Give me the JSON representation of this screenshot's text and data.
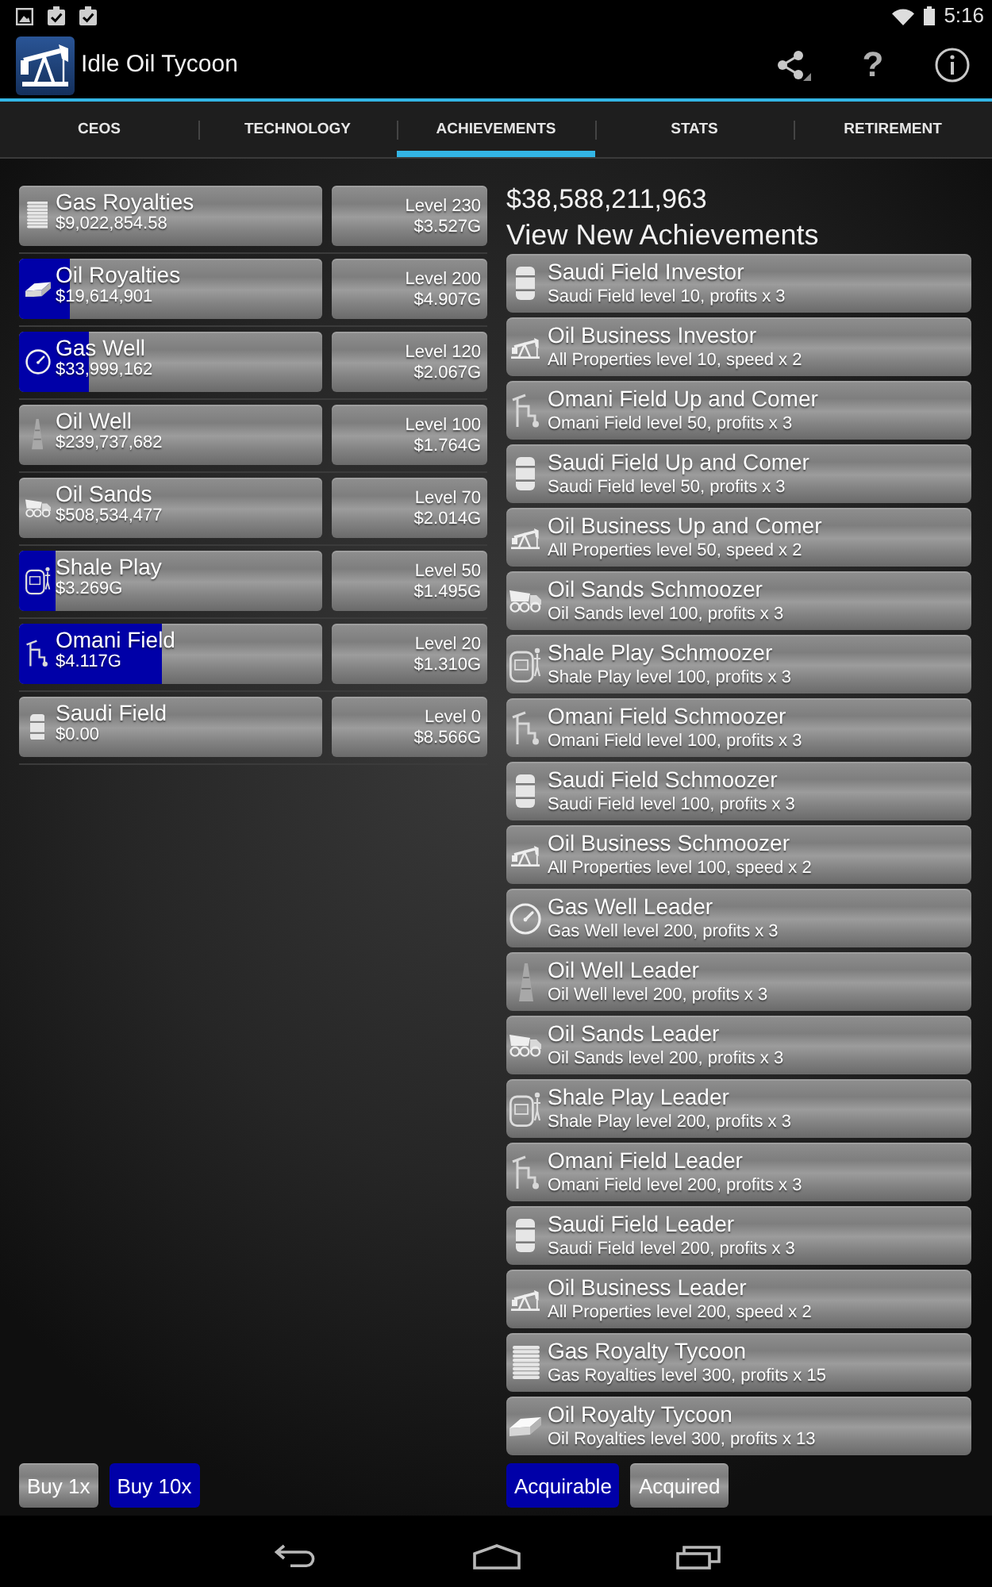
{
  "status_bar": {
    "time": "5:16"
  },
  "app_bar": {
    "title": "Idle Oil Tycoon",
    "help": "?"
  },
  "tabs": [
    {
      "label": "CEOS",
      "selected": false
    },
    {
      "label": "TECHNOLOGY",
      "selected": false
    },
    {
      "label": "ACHIEVEMENTS",
      "selected": true
    },
    {
      "label": "STATS",
      "selected": false
    },
    {
      "label": "RETIREMENT",
      "selected": false
    }
  ],
  "properties": [
    {
      "kind": "coins",
      "name": "Gas Royalties",
      "earnings": "$9,022,854.58",
      "level_text": "Level 230",
      "cost": "$3.527G"
    },
    {
      "kind": "ingot",
      "name": "Oil Royalties",
      "earnings": "$19,614,901",
      "level": 0.17,
      "level_text": "Level 200",
      "cost": "$4.907G"
    },
    {
      "kind": "gauge",
      "name": "Gas Well",
      "earnings": "$33,999,162",
      "level": 0.23,
      "level_text": "Level 120",
      "cost": "$2.067G"
    },
    {
      "kind": "derrick",
      "name": "Oil Well",
      "earnings": "$239,737,682",
      "level_text": "Level 100",
      "cost": "$1.764G"
    },
    {
      "kind": "truck",
      "name": "Oil Sands",
      "earnings": "$508,534,477",
      "level_text": "Level 70",
      "cost": "$2.014G"
    },
    {
      "kind": "tank",
      "name": "Shale Play",
      "earnings": "$3.269G",
      "level": 0.12,
      "level_text": "Level 50",
      "cost": "$1.495G"
    },
    {
      "kind": "pipeline",
      "name": "Omani Field",
      "earnings": "$4.117G",
      "level": 0.47,
      "level_text": "Level 20",
      "cost": "$1.310G"
    },
    {
      "kind": "barrel",
      "name": "Saudi Field",
      "earnings": "$0.00",
      "level_text": "Level 0",
      "cost": "$8.566G"
    }
  ],
  "buy_modes": [
    {
      "label": "Buy 1x",
      "selected": false
    },
    {
      "label": "Buy 10x",
      "selected": true
    }
  ],
  "balance": "$38,588,211,963",
  "achievements_heading": "View New Achievements",
  "achievements": [
    {
      "kind": "barrel",
      "title": "Saudi Field Investor",
      "requirement": "Saudi Field level 10, profits x 3"
    },
    {
      "kind": "pumpjack",
      "title": "Oil Business Investor",
      "requirement": "All Properties level 10, speed x 2"
    },
    {
      "kind": "pipeline",
      "title": "Omani Field Up and Comer",
      "requirement": "Omani Field level 50, profits x 3"
    },
    {
      "kind": "barrel",
      "title": "Saudi Field Up and Comer",
      "requirement": "Saudi Field level 50, profits x 3"
    },
    {
      "kind": "pumpjack",
      "title": "Oil Business Up and Comer",
      "requirement": "All Properties level 50, speed x 2"
    },
    {
      "kind": "truck",
      "title": "Oil Sands Schmoozer",
      "requirement": "Oil Sands level 100, profits x 3"
    },
    {
      "kind": "tank",
      "title": "Shale Play Schmoozer",
      "requirement": "Shale Play level 100, profits x 3"
    },
    {
      "kind": "pipeline",
      "title": "Omani Field Schmoozer",
      "requirement": "Omani Field level 100, profits x 3"
    },
    {
      "kind": "barrel",
      "title": "Saudi Field Schmoozer",
      "requirement": "Saudi Field level 100, profits x 3"
    },
    {
      "kind": "pumpjack",
      "title": "Oil Business Schmoozer",
      "requirement": "All Properties level 100, speed x 2"
    },
    {
      "kind": "gauge",
      "title": "Gas Well Leader",
      "requirement": "Gas Well level 200, profits x 3"
    },
    {
      "kind": "derrick",
      "title": "Oil Well Leader",
      "requirement": "Oil Well level 200, profits x 3"
    },
    {
      "kind": "truck",
      "title": "Oil Sands Leader",
      "requirement": "Oil Sands level 200, profits x 3"
    },
    {
      "kind": "tank",
      "title": "Shale Play Leader",
      "requirement": "Shale Play level 200, profits x 3"
    },
    {
      "kind": "pipeline",
      "title": "Omani Field Leader",
      "requirement": "Omani Field level 200, profits x 3"
    },
    {
      "kind": "barrel",
      "title": "Saudi Field Leader",
      "requirement": "Saudi Field level 200, profits x 3"
    },
    {
      "kind": "pumpjack",
      "title": "Oil Business Leader",
      "requirement": "All Properties level 200, speed x 2"
    },
    {
      "kind": "coins",
      "title": "Gas Royalty Tycoon",
      "requirement": "Gas Royalties level 300, profits x 15"
    },
    {
      "kind": "ingot",
      "title": "Oil Royalty Tycoon",
      "requirement": "Oil Royalties level 300, profits x 13"
    }
  ],
  "achievement_filters": [
    {
      "label": "Acquirable",
      "selected": true
    },
    {
      "label": "Acquired",
      "selected": false
    }
  ]
}
